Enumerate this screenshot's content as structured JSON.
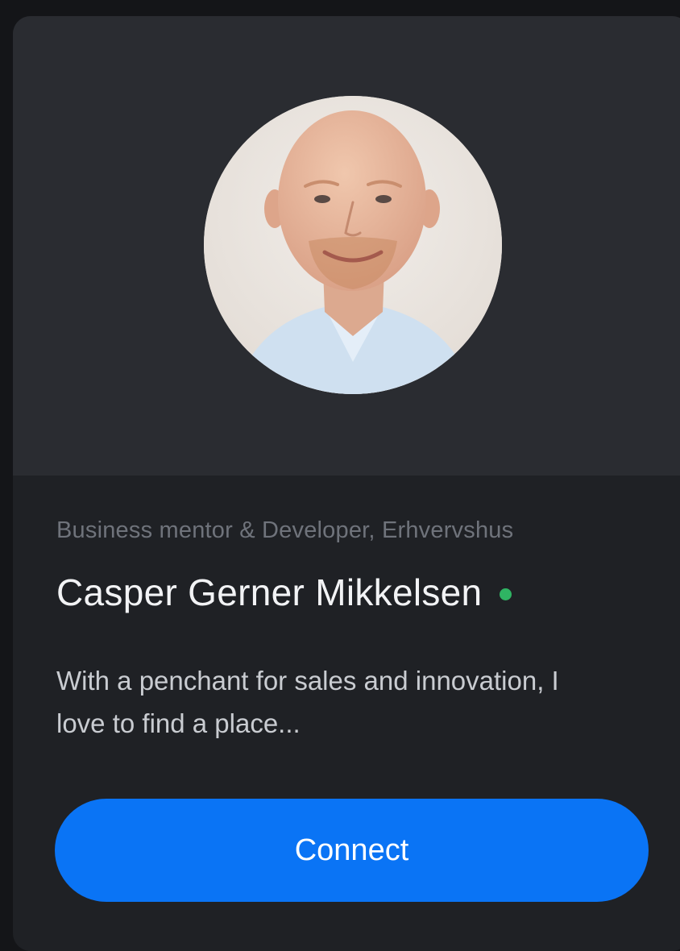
{
  "profile": {
    "subtitle": "Business mentor & Developer, Erhvervshus",
    "name": "Casper Gerner Mikkelsen",
    "online": true,
    "bio": "With a penchant for sales and innovation, I love to find a place..."
  },
  "actions": {
    "connect_label": "Connect"
  },
  "colors": {
    "page_bg": "#141518",
    "card_bg": "#1f2125",
    "header_bg": "#2a2c31",
    "accent": "#0a74f5",
    "status_online": "#2fb463"
  },
  "icons": {
    "avatar": "profile-photo",
    "status": "online-status-dot"
  }
}
